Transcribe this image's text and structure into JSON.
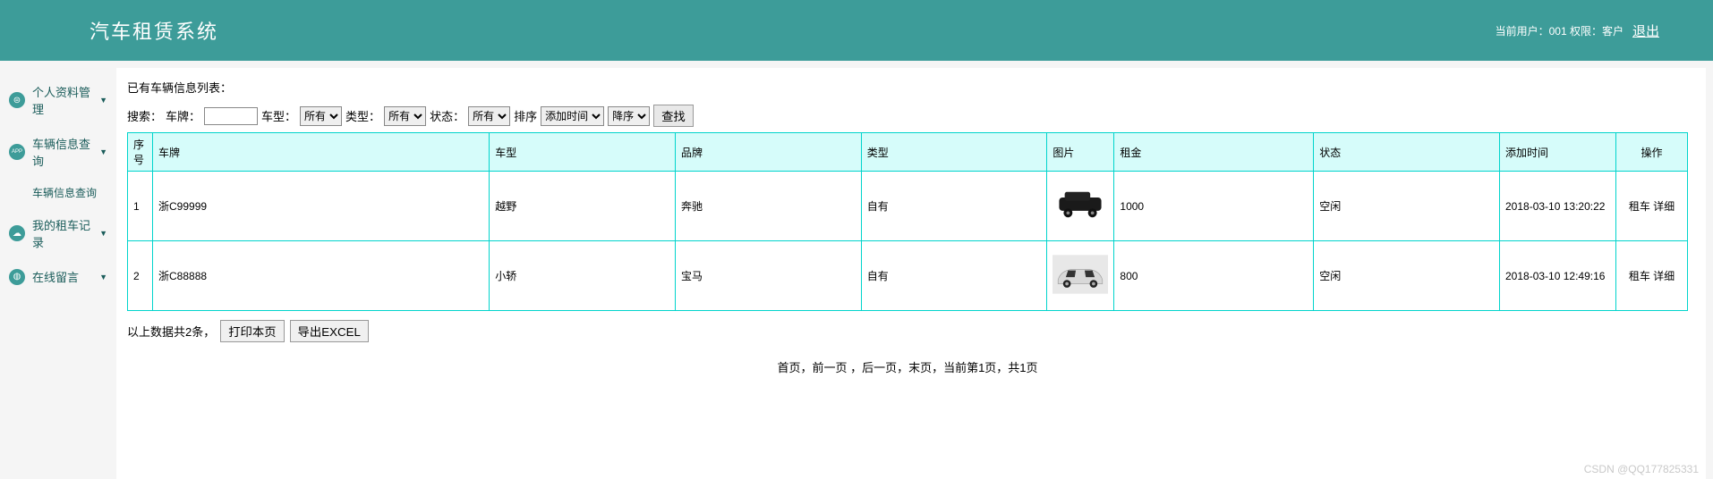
{
  "header": {
    "title": "汽车租赁系统",
    "userinfo": "当前用户：001  权限：客户",
    "logout": "退出"
  },
  "sidebar": {
    "items": [
      {
        "label": "个人资料管理",
        "icon": "⊜"
      },
      {
        "label": "车辆信息查询",
        "icon": "APP"
      },
      {
        "label": "我的租车记录",
        "icon": "☁"
      },
      {
        "label": "在线留言",
        "icon": "📊"
      }
    ],
    "sub_vehicle_query": "车辆信息查询"
  },
  "main": {
    "list_title": "已有车辆信息列表：",
    "filter": {
      "search_label": "搜索：",
      "plate_label": "车牌：",
      "type_label": "车型：",
      "type_value": "所有",
      "kind_label": "类型：",
      "kind_value": "所有",
      "status_label": "状态：",
      "status_value": "所有",
      "sort_label": "排序",
      "sort_field": "添加时间",
      "sort_dir": "降序",
      "search_btn": "查找"
    },
    "columns": {
      "no": "序号",
      "plate": "车牌",
      "type": "车型",
      "brand": "品牌",
      "kind": "类型",
      "image": "图片",
      "rent": "租金",
      "status": "状态",
      "added": "添加时间",
      "ops": "操作"
    },
    "rows": [
      {
        "no": "1",
        "plate": "浙C99999",
        "type": "越野",
        "brand": "奔驰",
        "kind": "自有",
        "rent": "1000",
        "status": "空闲",
        "added": "2018-03-10 13:20:22",
        "op_rent": "租车",
        "op_detail": "详细"
      },
      {
        "no": "2",
        "plate": "浙C88888",
        "type": "小轿",
        "brand": "宝马",
        "kind": "自有",
        "rent": "800",
        "status": "空闲",
        "added": "2018-03-10 12:49:16",
        "op_rent": "租车",
        "op_detail": "详细"
      }
    ],
    "summary": "以上数据共2条，",
    "print_btn": "打印本页",
    "export_btn": "导出EXCEL",
    "pager": "首页，前一页 ，后一页，末页，当前第1页，共1页",
    "watermark": "CSDN @QQ177825331"
  }
}
